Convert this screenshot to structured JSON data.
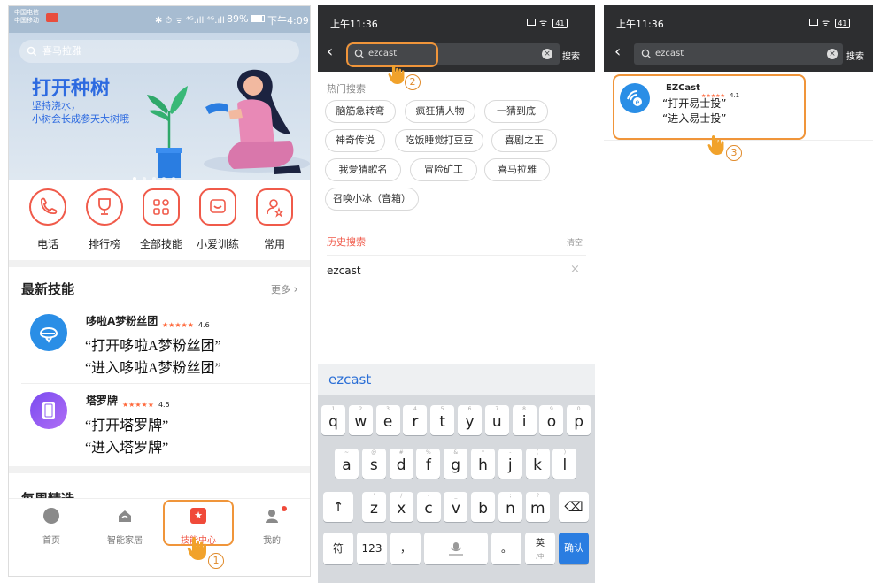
{
  "panel1": {
    "status": {
      "carrier1": "中国电信",
      "carrier2": "中国移动",
      "icons": "✱ ⏱ ᯤ ⁴ᴳ.ıll ⁴ᴳ.ıll",
      "battery": "89%",
      "time": "下午4:09"
    },
    "search_placeholder": "喜马拉雅",
    "banner": {
      "title": "打开种树",
      "line1": "坚持浇水，",
      "line2": "小树会长成参天大树哦"
    },
    "quick_actions": [
      {
        "label": "电话",
        "icon": "phone-icon"
      },
      {
        "label": "排行榜",
        "icon": "trophy-icon"
      },
      {
        "label": "全部技能",
        "icon": "grid-icon"
      },
      {
        "label": "小爱训练",
        "icon": "chat-icon"
      },
      {
        "label": "常用",
        "icon": "user-star-icon"
      }
    ],
    "latest": {
      "title": "最新技能",
      "more": "更多",
      "skills": [
        {
          "name": "哆啦A梦粉丝团",
          "stars": "★★★★★",
          "rating": "4.6",
          "cmd1": "“打开哆啦A梦粉丝团”",
          "cmd2": "“进入哆啦A梦粉丝团”"
        },
        {
          "name": "塔罗牌",
          "stars": "★★★★★",
          "rating": "4.5",
          "cmd1": "“打开塔罗牌”",
          "cmd2": "“进入塔罗牌”"
        }
      ]
    },
    "weekly_title": "每周精选",
    "tabs": [
      {
        "label": "首页",
        "icon": "compass-icon"
      },
      {
        "label": "智能家居",
        "icon": "home-icon"
      },
      {
        "label": "技能中心",
        "icon": "star-box-icon"
      },
      {
        "label": "我的",
        "icon": "person-icon"
      }
    ],
    "step": "1"
  },
  "panel2": {
    "status": {
      "time": "上午11:36",
      "battery": "41"
    },
    "query": "ezcast",
    "search_button": "搜索",
    "hot_title": "热门搜索",
    "hot_items": [
      "脑筋急转弯",
      "疯狂猜人物",
      "一猜到底",
      "神奇传说",
      "吃饭睡觉打豆豆",
      "喜剧之王",
      "我爱猜歌名",
      "冒险矿工",
      "喜马拉雅",
      "召唤小冰（音箱）"
    ],
    "history_title": "历史搜索",
    "clear": "清空",
    "history_items": [
      "ezcast"
    ],
    "suggestion": "ezcast",
    "keyboard": {
      "row1": [
        [
          "q",
          "1"
        ],
        [
          "w",
          "2"
        ],
        [
          "e",
          "3"
        ],
        [
          "r",
          "4"
        ],
        [
          "t",
          "5"
        ],
        [
          "y",
          "6"
        ],
        [
          "u",
          "7"
        ],
        [
          "i",
          "8"
        ],
        [
          "o",
          "9"
        ],
        [
          "p",
          "0"
        ]
      ],
      "row2": [
        [
          "a",
          "~"
        ],
        [
          "s",
          "@"
        ],
        [
          "d",
          "#"
        ],
        [
          "f",
          "%"
        ],
        [
          "g",
          "&"
        ],
        [
          "h",
          "*"
        ],
        [
          "j",
          "-"
        ],
        [
          "k",
          "("
        ],
        [
          "l",
          ")"
        ]
      ],
      "row3": [
        [
          "z",
          "'"
        ],
        [
          "x",
          "/"
        ],
        [
          "c",
          "-"
        ],
        [
          "v",
          "_"
        ],
        [
          "b",
          ":"
        ],
        [
          "n",
          ";"
        ],
        [
          "m",
          "?"
        ]
      ],
      "shift": "↑",
      "backspace": "⌫",
      "symbols": "符",
      "numbers": "123",
      "comma": "，",
      "period": "。",
      "lang": "英",
      "lang_sub": "/中",
      "confirm": "确认"
    },
    "step": "2"
  },
  "panel3": {
    "status": {
      "time": "上午11:36",
      "battery": "41"
    },
    "query": "ezcast",
    "search_button": "搜索",
    "result": {
      "name": "EZCast",
      "stars": "★★★★★",
      "rating": "4.1",
      "cmd1": "“打开易士投”",
      "cmd2": "“进入易士投”"
    },
    "step": "3"
  },
  "colors": {
    "accent": "#f05a4a",
    "highlight": "#f0953a",
    "link_blue": "#2b6fd6"
  }
}
